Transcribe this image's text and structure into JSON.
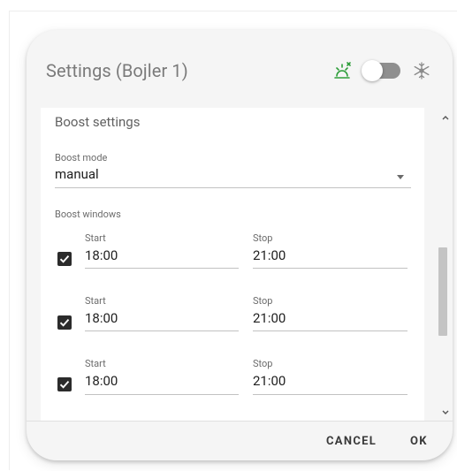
{
  "dialog": {
    "title": "Settings (Bojler 1)",
    "icons": {
      "heat": "weather-heat-icon",
      "cool": "snowflake-icon"
    },
    "toggle": {
      "on": false
    },
    "colors": {
      "heat_icon": "#2e9e3a",
      "toggle_track": "#8f8f8f",
      "checkbox": "#2b2b2b"
    }
  },
  "boost": {
    "section_title": "Boost settings",
    "mode_label": "Boost mode",
    "mode_value": "manual",
    "windows_label": "Boost windows",
    "windows": [
      {
        "checked": true,
        "start_label": "Start",
        "start": "18:00",
        "stop_label": "Stop",
        "stop": "21:00"
      },
      {
        "checked": true,
        "start_label": "Start",
        "start": "18:00",
        "stop_label": "Stop",
        "stop": "21:00"
      },
      {
        "checked": true,
        "start_label": "Start",
        "start": "18:00",
        "stop_label": "Stop",
        "stop": "21:00"
      }
    ]
  },
  "actions": {
    "cancel": "CANCEL",
    "ok": "OK"
  }
}
